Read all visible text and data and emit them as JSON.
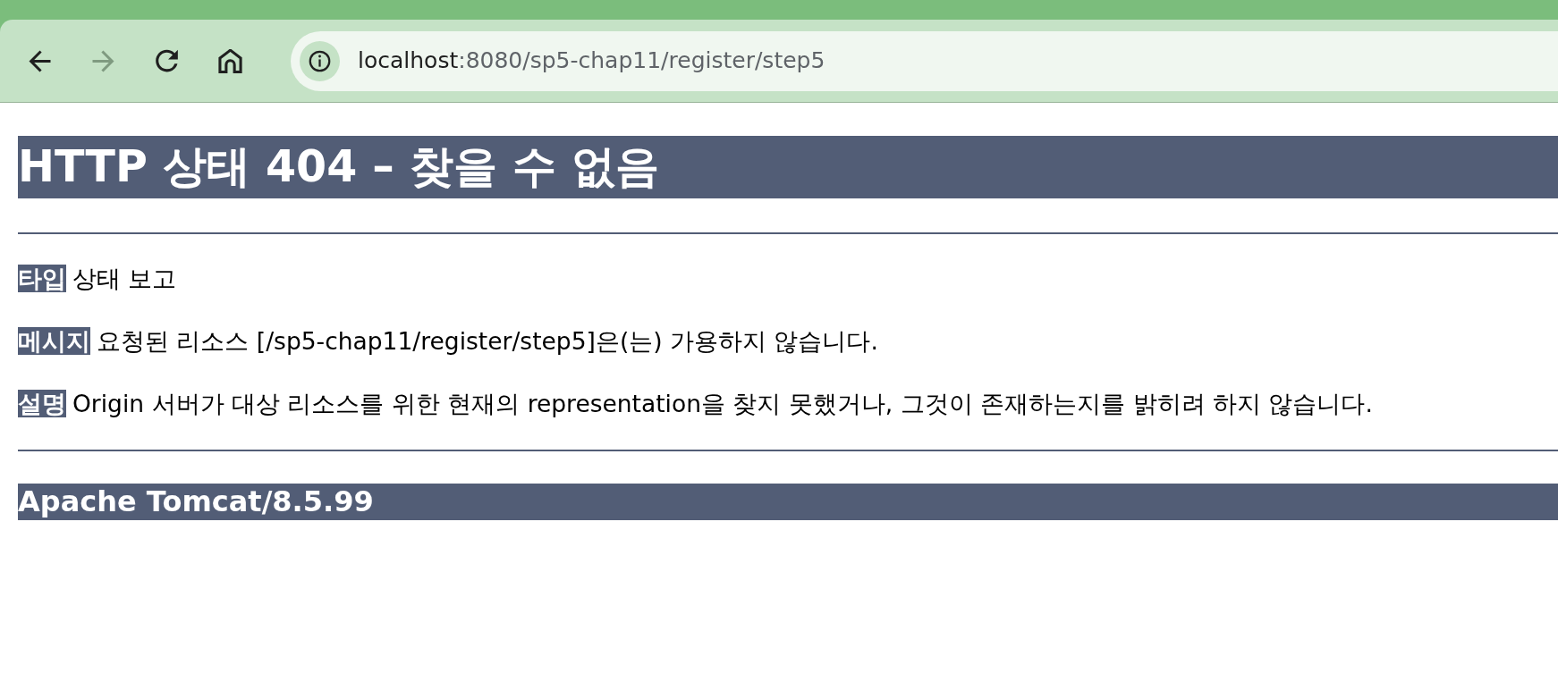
{
  "browser": {
    "nav_buttons": [
      {
        "kind": "back",
        "disabled": false
      },
      {
        "kind": "forward",
        "disabled": true
      },
      {
        "kind": "reload",
        "disabled": false
      },
      {
        "kind": "home",
        "disabled": false
      }
    ],
    "address_bar": {
      "host": "localhost",
      "path": ":8080/sp5-chap11/register/step5"
    }
  },
  "page": {
    "title": "HTTP 상태 404 – 찾을 수 없음",
    "fields": [
      {
        "label": "타입",
        "value": "상태 보고"
      },
      {
        "label": "메시지",
        "value": "요청된 리소스 [/sp5-chap11/register/step5]은(는) 가용하지 않습니다."
      },
      {
        "label": "설명",
        "value": "Origin 서버가 대상 리소스를 위한 현재의 representation을 찾지 못했거나, 그것이 존재하는지를 밝히려 하지 않습니다."
      }
    ],
    "footer": "Apache Tomcat/8.5.99"
  }
}
